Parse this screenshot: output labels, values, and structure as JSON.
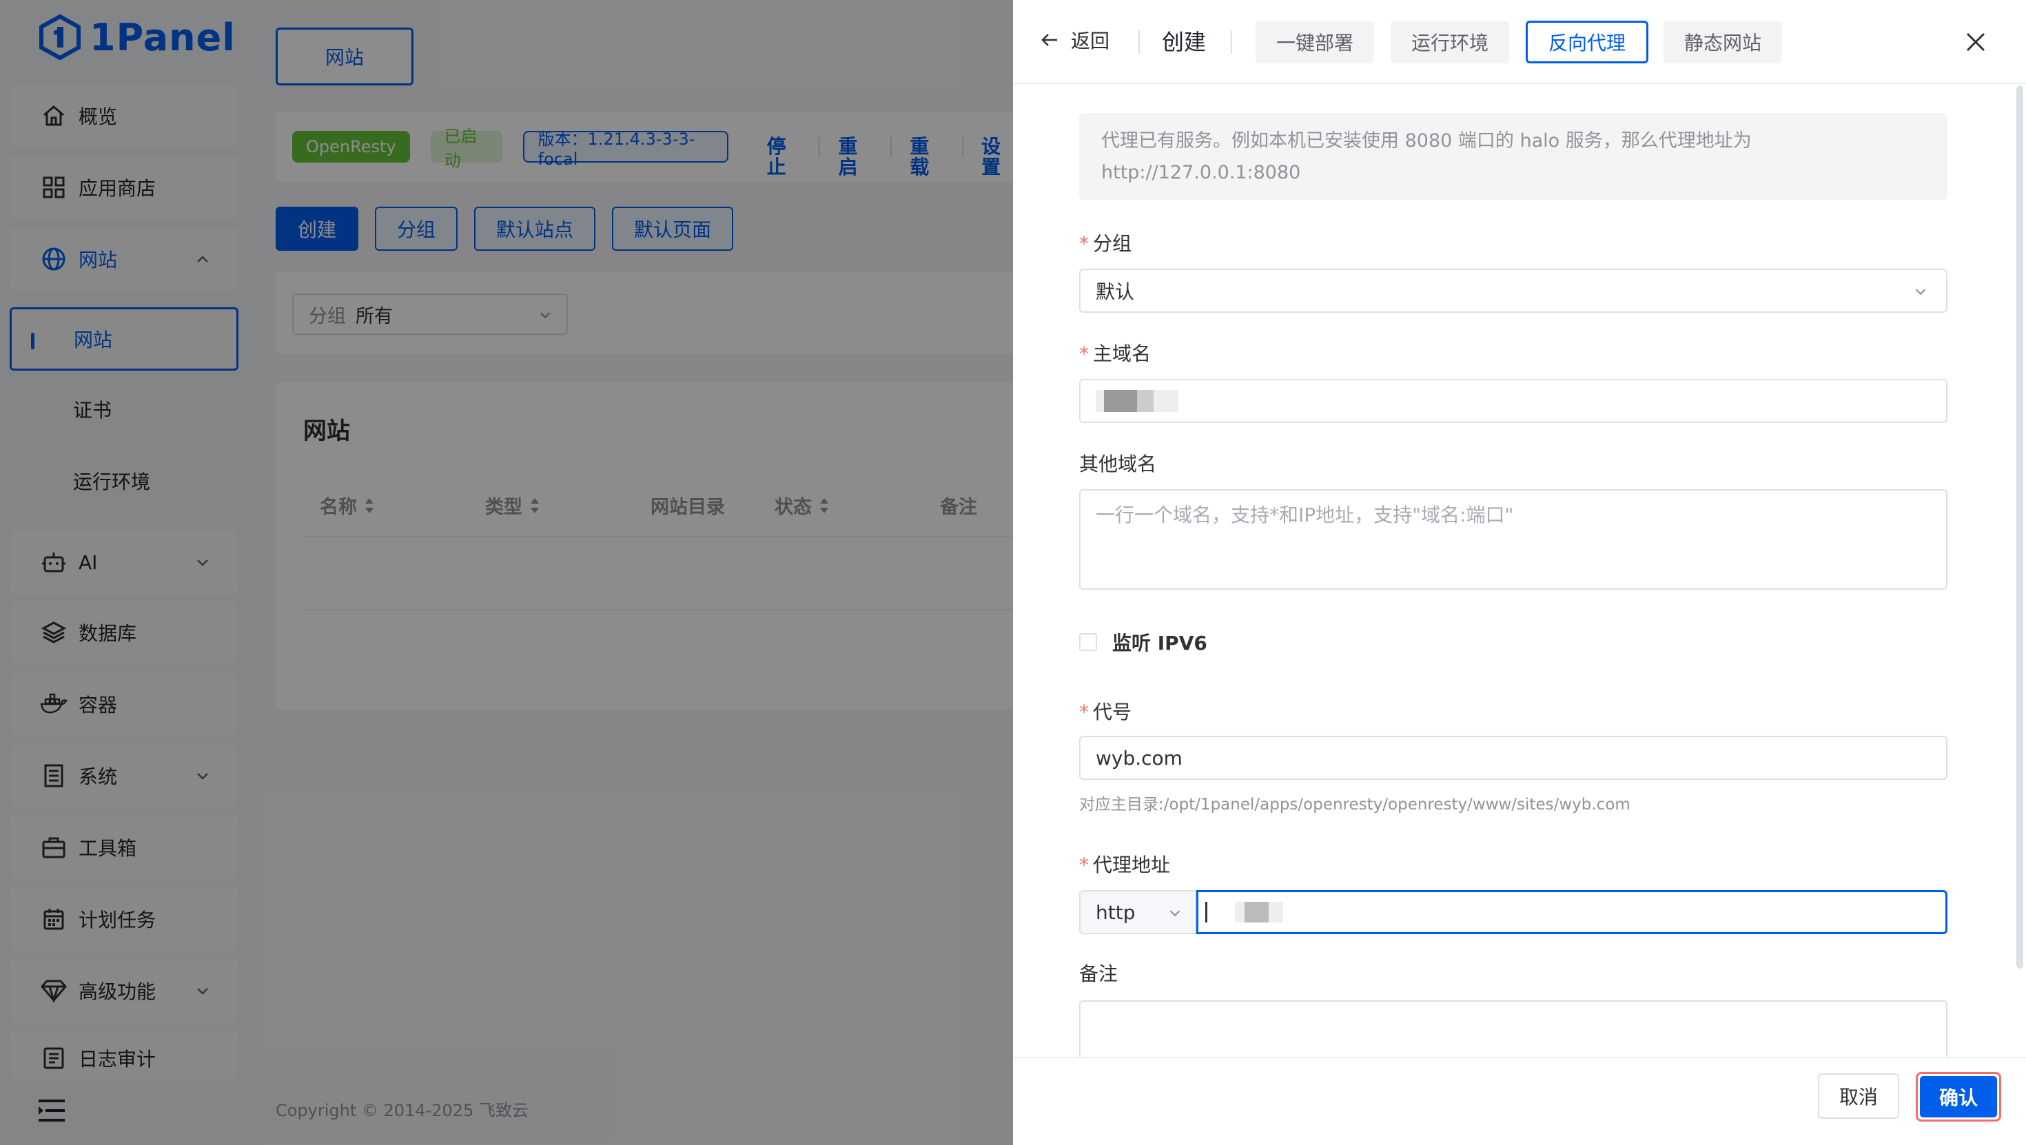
{
  "app": {
    "logo_text": "1Panel"
  },
  "sidebar": {
    "items": [
      {
        "label": "概览",
        "icon": "home-icon"
      },
      {
        "label": "应用商店",
        "icon": "grid-icon"
      },
      {
        "label": "网站",
        "icon": "globe-icon",
        "expanded": true
      },
      {
        "label": "AI",
        "icon": "robot-icon"
      },
      {
        "label": "数据库",
        "icon": "layers-icon"
      },
      {
        "label": "容器",
        "icon": "docker-icon"
      },
      {
        "label": "系统",
        "icon": "server-icon"
      },
      {
        "label": "工具箱",
        "icon": "toolbox-icon"
      },
      {
        "label": "计划任务",
        "icon": "calendar-icon"
      },
      {
        "label": "高级功能",
        "icon": "diamond-icon"
      },
      {
        "label": "日志审计",
        "icon": "log-icon"
      }
    ],
    "sub_items": [
      {
        "label": "网站",
        "active": true
      },
      {
        "label": "证书"
      },
      {
        "label": "运行环境"
      }
    ]
  },
  "main": {
    "tab_label": "网站",
    "status": {
      "app_name": "OpenResty",
      "state": "已启动",
      "version": "版本：1.21.4.3-3-3-focal",
      "actions": [
        "停止",
        "重启",
        "重载",
        "设置"
      ]
    },
    "buttons": [
      "创建",
      "分组",
      "默认站点",
      "默认页面"
    ],
    "filter": {
      "label": "分组",
      "value": "所有"
    },
    "table": {
      "title": "网站",
      "columns": [
        "名称",
        "类型",
        "网站目录",
        "状态",
        "备注"
      ]
    },
    "footer": "Copyright © 2014-2025 飞致云"
  },
  "drawer": {
    "back_label": "返回",
    "title": "创建",
    "tabs": [
      {
        "label": "一键部署"
      },
      {
        "label": "运行环境"
      },
      {
        "label": "反向代理",
        "active": true
      },
      {
        "label": "静态网站"
      }
    ],
    "alert": "代理已有服务。例如本机已安装使用 8080 端口的 halo 服务，那么代理地址为 http://127.0.0.1:8080",
    "form": {
      "group_label": "分组",
      "group_value": "默认",
      "primary_domain_label": "主域名",
      "other_domains_label": "其他域名",
      "other_domains_placeholder": "一行一个域名，支持*和IP地址，支持\"域名:端口\"",
      "ipv6_label": "监听 IPV6",
      "alias_label": "代号",
      "alias_value": "wyb.com",
      "alias_hint": "对应主目录:/opt/1panel/apps/openresty/openresty/www/sites/wyb.com",
      "proxy_label": "代理地址",
      "proxy_protocol": "http",
      "remark_label": "备注"
    },
    "cancel_label": "取消",
    "confirm_label": "确认"
  },
  "colors": {
    "primary": "#005eeb",
    "success": "#67c23a",
    "danger": "#f56c6c"
  }
}
